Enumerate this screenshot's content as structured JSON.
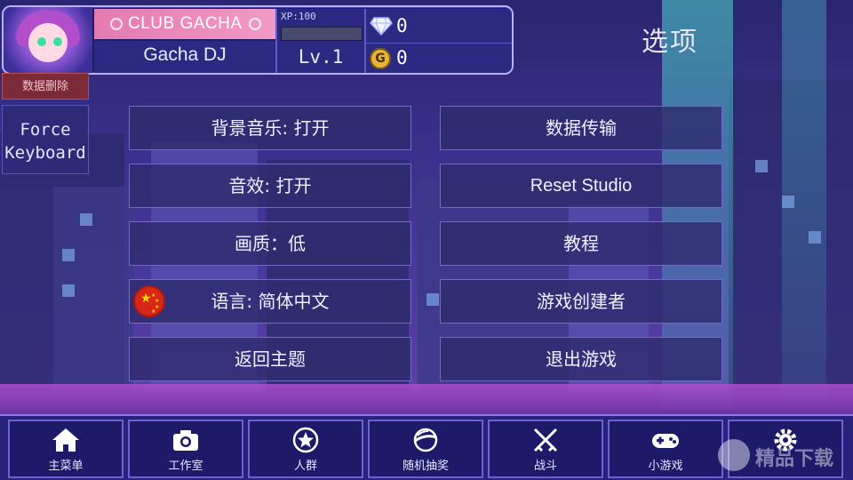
{
  "hud": {
    "club_label": "CLUB GACHA",
    "player_name": "Gacha DJ",
    "xp_label": "XP:100",
    "xp_progress": 0,
    "level": "Lv.1",
    "gems": "0",
    "gold": "0",
    "gold_glyph": "G"
  },
  "page_title": "选项",
  "side": {
    "delete_data": "数据删除",
    "force_keyboard": "Force Keyboard"
  },
  "options_left": [
    {
      "id": "bgm",
      "label": "背景音乐: 打开"
    },
    {
      "id": "sfx",
      "label": "音效: 打开"
    },
    {
      "id": "quality",
      "label": "画质：低"
    },
    {
      "id": "language",
      "label": "语言: 简体中文"
    },
    {
      "id": "back",
      "label": "返回主题"
    }
  ],
  "options_right": [
    {
      "id": "transfer",
      "label": "数据传输"
    },
    {
      "id": "reset",
      "label": "Reset Studio"
    },
    {
      "id": "tutorial",
      "label": "教程"
    },
    {
      "id": "creators",
      "label": "游戏创建者"
    },
    {
      "id": "exit",
      "label": "退出游戏"
    }
  ],
  "nav": [
    {
      "label": "主菜单",
      "icon": "home-icon"
    },
    {
      "label": "工作室",
      "icon": "camera-icon"
    },
    {
      "label": "人群",
      "icon": "star-icon"
    },
    {
      "label": "随机抽奖",
      "icon": "gacha-orb-icon"
    },
    {
      "label": "战斗",
      "icon": "crossed-swords-icon"
    },
    {
      "label": "小游戏",
      "icon": "gamepad-icon"
    },
    {
      "label": "",
      "icon": "gear-icon"
    }
  ],
  "watermark": "精品下载",
  "colors": {
    "gold": "#e7b43a",
    "beam": "#50dcd2",
    "club_pink": "#f29ac4"
  }
}
